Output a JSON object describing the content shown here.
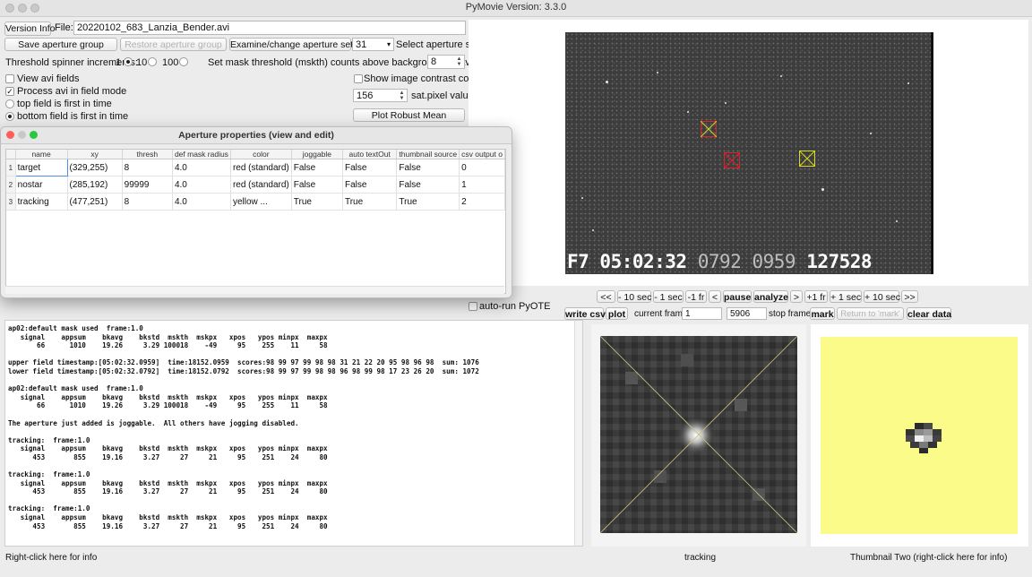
{
  "window": {
    "title": "PyMovie  Version: 3.3.0"
  },
  "top": {
    "version_info_button": "Version Info",
    "file_label": "File:",
    "file_name": "20220102_683_Lanzia_Bender.avi",
    "save_aperture_group": "Save aperture group",
    "restore_aperture_group": "Restore aperture group",
    "examine_aperture_settings": "Examine/change aperture settings",
    "aperture_size_value": "31",
    "select_aperture_size": "Select aperture size",
    "threshold_increments_label": "Threshold spinner increments:",
    "increment_options": [
      "1",
      "10",
      "100"
    ],
    "increment_selected": "10",
    "mask_threshold_label": "Set mask threshold (mskth) counts above background (bkavg)",
    "mask_threshold_value": "8",
    "view_avi_fields": "View avi fields",
    "process_avi_field_mode": "Process avi in field mode",
    "top_field_first": "top field is first in time",
    "bottom_field_first": "bottom field is first in time",
    "show_image_contrast": "Show image contrast control",
    "sat_pixel_value": "156",
    "sat_pixel_label": "sat.pixel value",
    "plot_robust_mean": "Plot Robust Mean"
  },
  "dialog": {
    "title": "Aperture properties (view and edit)",
    "columns": [
      "name",
      "xy",
      "thresh",
      "def mask radius",
      "color",
      "joggable",
      "auto textOut",
      "thumbnail source",
      "csv output o"
    ],
    "rows": [
      [
        "1",
        "target",
        "(329,255)",
        "8",
        "4.0",
        "red (standard)",
        "False",
        "False",
        "False",
        "0"
      ],
      [
        "2",
        "nostar",
        "(285,192)",
        "99999",
        "4.0",
        "red (standard)",
        "False",
        "False",
        "False",
        "1"
      ],
      [
        "3",
        "tracking",
        "(477,251)",
        "8",
        "4.0",
        "yellow ...",
        "True",
        "True",
        "True",
        "2"
      ]
    ]
  },
  "video": {
    "vti_prefix": "F7 05:02:32 ",
    "vti_dim1": "0792",
    "vti_dim2": "0959",
    "vti_suffix": "127528"
  },
  "playback": {
    "buttons": [
      "<<",
      "- 10 sec",
      "- 1 sec",
      "-1 fr",
      "<",
      "pause",
      "analyze",
      ">",
      "+1 fr",
      "+ 1 sec",
      "+ 10 sec",
      ">>"
    ],
    "auto_run_pyote": "auto-run PyOTE",
    "write_csv": "write csv",
    "plot": "plot",
    "current_frame_label": "current frame",
    "current_frame_value": "1",
    "stop_frame_value": "5906",
    "stop_frame_label": "stop frame",
    "mark": "mark",
    "return_to_mark": "Return to 'mark'",
    "clear_data": "clear data"
  },
  "log": {
    "text": "ap02:default mask used  frame:1.0\n   signal    appsum    bkavg    bkstd  mskth  mskpx   xpos   ypos minpx  maxpx\n       66      1010    19.26     3.29 100018    -49     95    255    11     58\n\nupper field timestamp:[05:02:32.0959]  time:18152.0959  scores:98 99 97 99 98 98 31 21 22 20 95 98 96 98  sum: 1076\nlower field timestamp:[05:02:32.0792]  time:18152.0792  scores:98 99 97 99 98 98 96 98 99 98 17 23 26 20  sum: 1072\n\nap02:default mask used  frame:1.0\n   signal    appsum    bkavg    bkstd  mskth  mskpx   xpos   ypos minpx  maxpx\n       66      1010    19.26     3.29 100018    -49     95    255    11     58\n\nThe aperture just added is joggable.  All others have jogging disabled.\n\ntracking:  frame:1.0\n   signal    appsum    bkavg    bkstd  mskth  mskpx   xpos   ypos minpx  maxpx\n      453       855    19.16     3.27     27     21     95    251    24     80\n\ntracking:  frame:1.0\n   signal    appsum    bkavg    bkstd  mskth  mskpx   xpos   ypos minpx  maxpx\n      453       855    19.16     3.27     27     21     95    251    24     80\n\ntracking:  frame:1.0\n   signal    appsum    bkavg    bkstd  mskth  mskpx   xpos   ypos minpx  maxpx\n      453       855    19.16     3.27     27     21     95    251    24     80"
  },
  "status": {
    "left": "Right-click here for info",
    "thumb1_caption": "tracking",
    "thumb2_caption": "Thumbnail Two (right-click here for info)"
  },
  "colors": {
    "aperture_red": "#e0202a",
    "aperture_yellow": "#d8d820",
    "thumb2_bg": "#fbfb8a"
  }
}
